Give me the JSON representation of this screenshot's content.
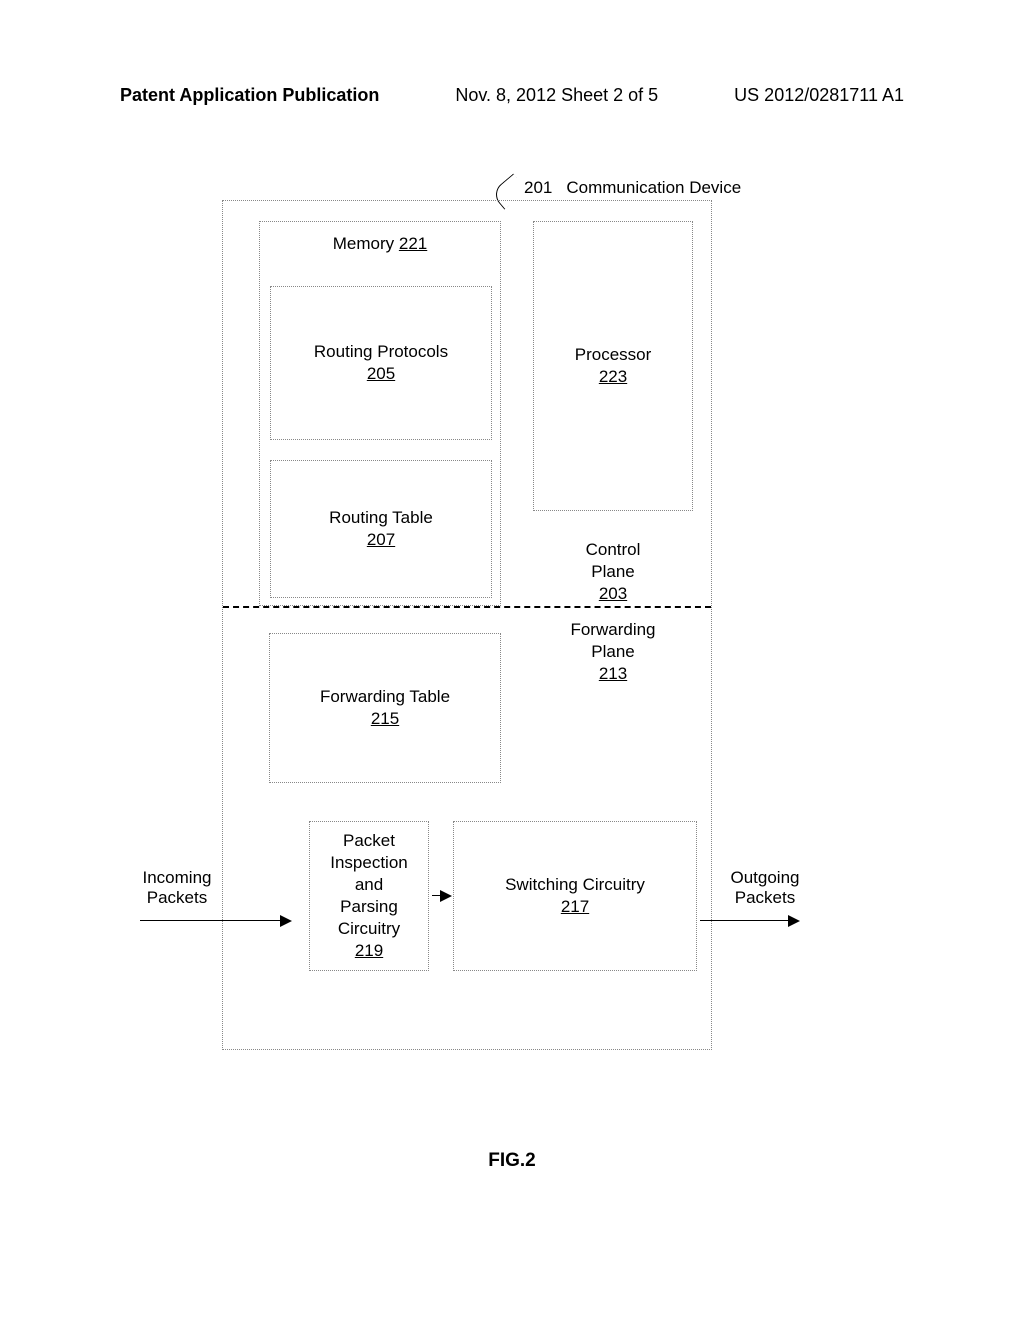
{
  "header": {
    "left": "Patent Application Publication",
    "center": "Nov. 8, 2012  Sheet 2 of 5",
    "right": "US 2012/0281711 A1"
  },
  "device": {
    "ref": "201",
    "label": "Communication Device",
    "memory": {
      "label": "Memory",
      "ref": "221"
    },
    "routingProtocols": {
      "label": "Routing Protocols",
      "ref": "205"
    },
    "routingTable": {
      "label": "Routing Table",
      "ref": "207"
    },
    "processor": {
      "label": "Processor",
      "ref": "223"
    },
    "controlPlane": {
      "label1": "Control",
      "label2": "Plane",
      "ref": "203"
    },
    "forwardingPlane": {
      "label1": "Forwarding",
      "label2": "Plane",
      "ref": "213"
    },
    "forwardingTable": {
      "label": "Forwarding Table",
      "ref": "215"
    },
    "packetInspection": {
      "l1": "Packet",
      "l2": "Inspection",
      "l3": "and",
      "l4": "Parsing",
      "l5": "Circuitry",
      "ref": "219"
    },
    "switching": {
      "label": "Switching Circuitry",
      "ref": "217"
    }
  },
  "io": {
    "incoming": {
      "l1": "Incoming",
      "l2": "Packets"
    },
    "outgoing": {
      "l1": "Outgoing",
      "l2": "Packets"
    }
  },
  "figure": "FIG.2"
}
